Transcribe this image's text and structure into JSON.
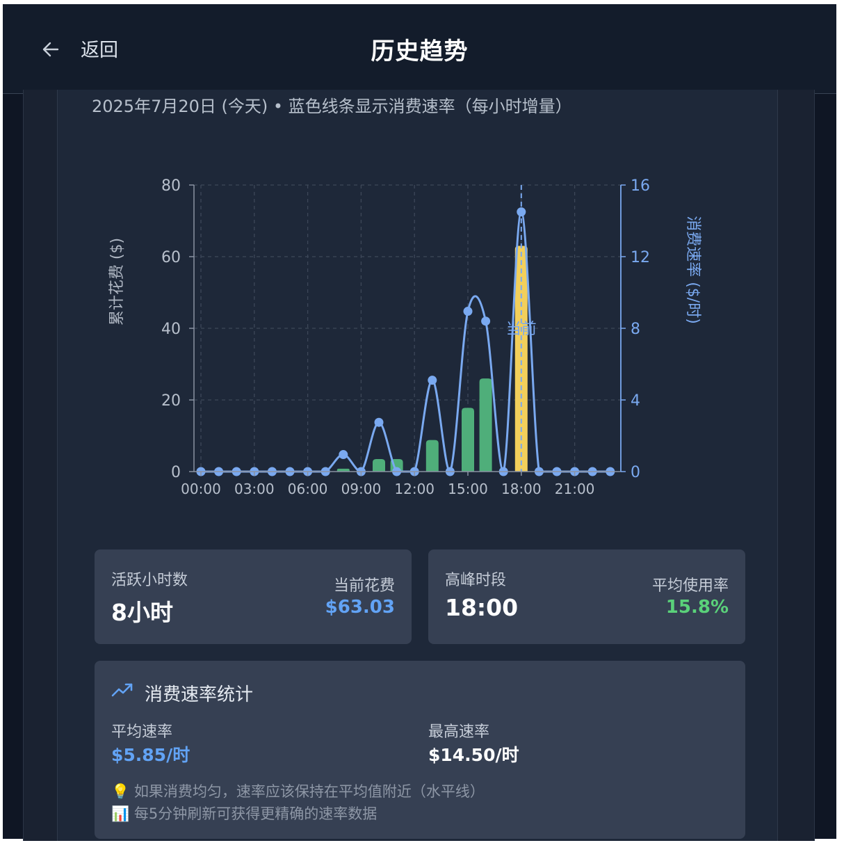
{
  "header": {
    "back_label": "返回",
    "title": "历史趋势"
  },
  "subtitle": "2025年7月20日 (今天) • 蓝色线条显示消费速率（每小时增量）",
  "chart_data": {
    "type": "bar+line",
    "x_ticks": [
      "00:00",
      "03:00",
      "06:00",
      "09:00",
      "12:00",
      "15:00",
      "18:00",
      "21:00"
    ],
    "y_left_label": "累计花费 ($)",
    "y_right_label": "消费速率 ($/时)",
    "y_left_ticks": [
      "0",
      "20",
      "40",
      "60",
      "80"
    ],
    "y_right_ticks": [
      "0",
      "4",
      "8",
      "12",
      "16"
    ],
    "y_left_lim": [
      0,
      80
    ],
    "y_right_lim": [
      0,
      16
    ],
    "grid": true,
    "current_marker": {
      "hour": 18,
      "label": "当前"
    },
    "hours": [
      0,
      1,
      2,
      3,
      4,
      5,
      6,
      7,
      8,
      9,
      10,
      11,
      12,
      13,
      14,
      15,
      16,
      17,
      18,
      19,
      20,
      21,
      22,
      23
    ],
    "cumulative_spend": [
      0,
      0,
      0,
      0,
      0,
      0,
      0,
      0,
      0.8,
      0,
      3.5,
      3.5,
      0,
      8.8,
      0,
      17.8,
      26,
      0,
      63,
      0,
      0,
      0,
      0,
      0
    ],
    "rate_per_hour": [
      0,
      0,
      0,
      0,
      0,
      0,
      0,
      0,
      0.95,
      0,
      2.75,
      0,
      0,
      5.1,
      0,
      8.95,
      8.4,
      0,
      14.5,
      0,
      0,
      0,
      0,
      0
    ],
    "colors": {
      "bar": "#4fae7a",
      "bar_current": "#f2cf5b",
      "line": "#7aa9f0",
      "axis": "#8a93a3",
      "grid": "#3d4759",
      "right_axis": "#7aa9f0"
    }
  },
  "stats": {
    "active_hours_label": "活跃小时数",
    "active_hours_value": "8小时",
    "current_spend_label": "当前花费",
    "current_spend_value": "$63.03",
    "peak_label": "高峰时段",
    "peak_value": "18:00",
    "avg_usage_label": "平均使用率",
    "avg_usage_value": "15.8%"
  },
  "rate_stats": {
    "title": "消费速率统计",
    "icon": "trending-up-icon",
    "avg_rate_label": "平均速率",
    "avg_rate_value": "$5.85/时",
    "max_rate_label": "最高速率",
    "max_rate_value": "$14.50/时",
    "note1_icon": "💡",
    "note1": "如果消费均匀，速率应该保持在平均值附近（水平线）",
    "note2_icon": "📊",
    "note2": "每5分钟刷新可获得更精确的速率数据"
  },
  "accent_colors": {
    "blue": "#62a3f5",
    "green": "#5ad17a"
  }
}
